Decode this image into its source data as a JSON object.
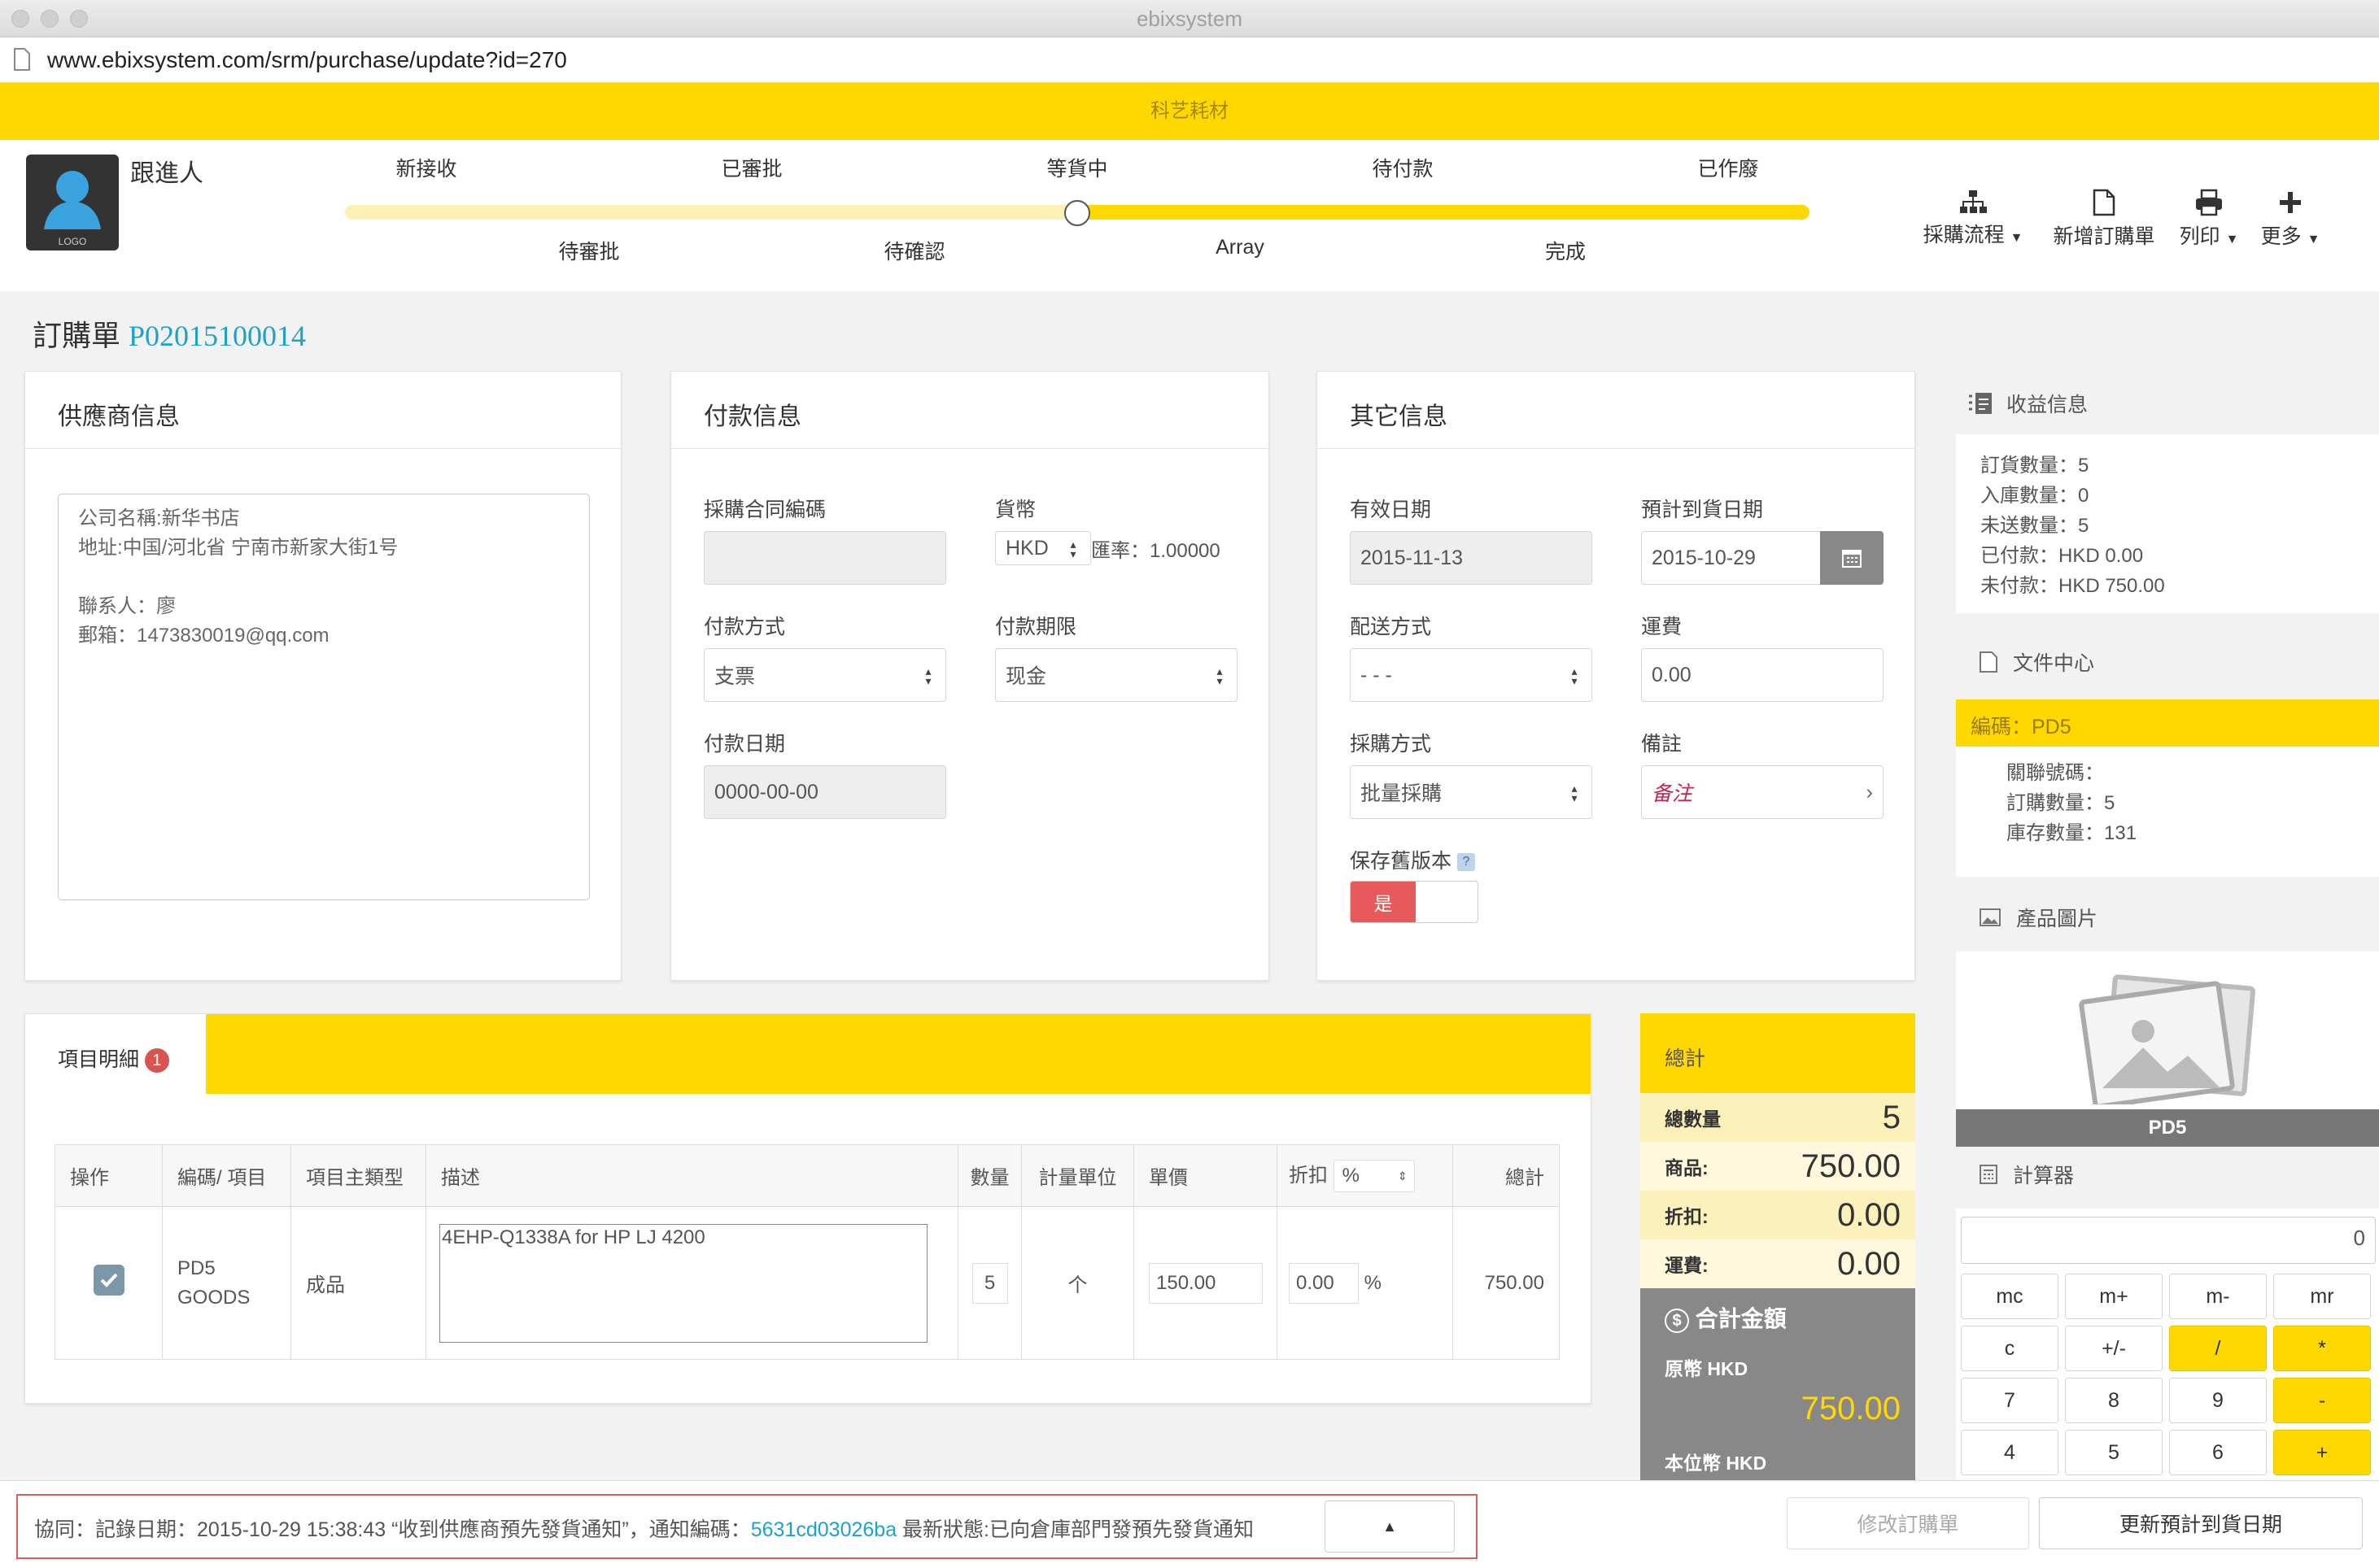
{
  "window": {
    "title": "ebixsystem",
    "url_host": "www.ebixsystem.com",
    "url_path": "/srm/purchase/update?id=270"
  },
  "banner": {
    "text": "科艺耗材"
  },
  "header": {
    "owner": "跟進人",
    "logo_text": "LOGO",
    "steps_top": [
      "新接收",
      "已審批",
      "等貨中",
      "待付款",
      "已作廢"
    ],
    "steps_bottom": [
      "待審批",
      "待確認",
      "Array",
      "完成"
    ],
    "progress": 0.5,
    "toolbar": {
      "flow": "採購流程",
      "new_order": "新增訂購單",
      "print": "列印",
      "more": "更多"
    }
  },
  "order": {
    "title": "訂購單",
    "number": "P02015100014"
  },
  "supplier": {
    "title": "供應商信息",
    "text": "公司名稱:新华书店\n地址:中国/河北省 宁南市新家大街1号\n\n聯系人：廖\n郵箱：1473830019@qq.com"
  },
  "payment": {
    "title": "付款信息",
    "contract_label": "採購合同編碼",
    "contract_value": "",
    "currency_label": "貨幣",
    "currency_value": "HKD",
    "rate_text": "匯率：1.00000",
    "method_label": "付款方式",
    "method_value": "支票",
    "term_label": "付款期限",
    "term_value": "现金",
    "date_label": "付款日期",
    "date_value": "0000-00-00"
  },
  "other": {
    "title": "其它信息",
    "valid_label": "有效日期",
    "valid_value": "2015-11-13",
    "eta_label": "預計到貨日期",
    "eta_value": "2015-10-29",
    "ship_label": "配送方式",
    "ship_value": "- - -",
    "freight_label": "運費",
    "freight_value": "0.00",
    "purchase_label": "採購方式",
    "purchase_value": "批量採購",
    "note_label": "備註",
    "note_value": "备注",
    "keep_label": "保存舊版本",
    "keep_help": "?",
    "keep_value": "是"
  },
  "items": {
    "tab_label": "項目明細",
    "tab_badge": "1",
    "headers": {
      "op": "操作",
      "code": "編碼/ 項目",
      "type": "項目主類型",
      "desc": "描述",
      "qty": "數量",
      "unit": "計量單位",
      "price": "單價",
      "discount": "折扣",
      "discount_unit": "%",
      "total": "總計"
    },
    "rows": [
      {
        "code": "PD5",
        "name": "GOODS",
        "type": "成品",
        "desc": "4EHP-Q1338A for HP LJ 4200",
        "qty": "5",
        "unit": "个",
        "price": "150.00",
        "discount": "0.00",
        "pct": "%",
        "total": "750.00"
      }
    ]
  },
  "totals": {
    "title": "總計",
    "qty_label": "總數量",
    "qty": "5",
    "goods_label": "商品:",
    "goods": "750.00",
    "disc_label": "折扣:",
    "disc": "0.00",
    "freight_label": "運費:",
    "freight": "0.00",
    "sum_title": "合計金額",
    "orig_label": "原幣 HKD",
    "orig_value": "750.00",
    "local_label": "本位幣 HKD"
  },
  "sidebar": {
    "profit_title": "收益信息",
    "profit_lines": [
      "訂貨數量：5",
      "入庫數量：0",
      "未送數量：5",
      "已付款：HKD 0.00",
      "未付款：HKD 750.00"
    ],
    "files_title": "文件中心",
    "code_label": "編碼：PD5",
    "file_lines": [
      "關聯號碼：",
      "訂購數量：5",
      "庫存數量：131"
    ],
    "image_title": "產品圖片",
    "image_caption": "PD5",
    "calc_title": "計算器",
    "calc_display": "0",
    "calc_keys": [
      "mc",
      "m+",
      "m-",
      "mr",
      "c",
      "+/-",
      "/",
      "*",
      "7",
      "8",
      "9",
      "-",
      "4",
      "5",
      "6",
      "+"
    ]
  },
  "footer": {
    "prefix": "協同：記錄日期：2015-10-29 15:38:43 “收到供應商預先發貨通知”，通知編碼：",
    "code": "5631cd03026ba",
    "suffix": " 最新狀態:已向倉庫部門發預先發貨通知",
    "modify": "修改訂購單",
    "update_eta": "更新預計到貨日期"
  },
  "colors": {
    "accent": "#ffd800",
    "link": "#1fa2c9",
    "red": "#e8595b"
  }
}
